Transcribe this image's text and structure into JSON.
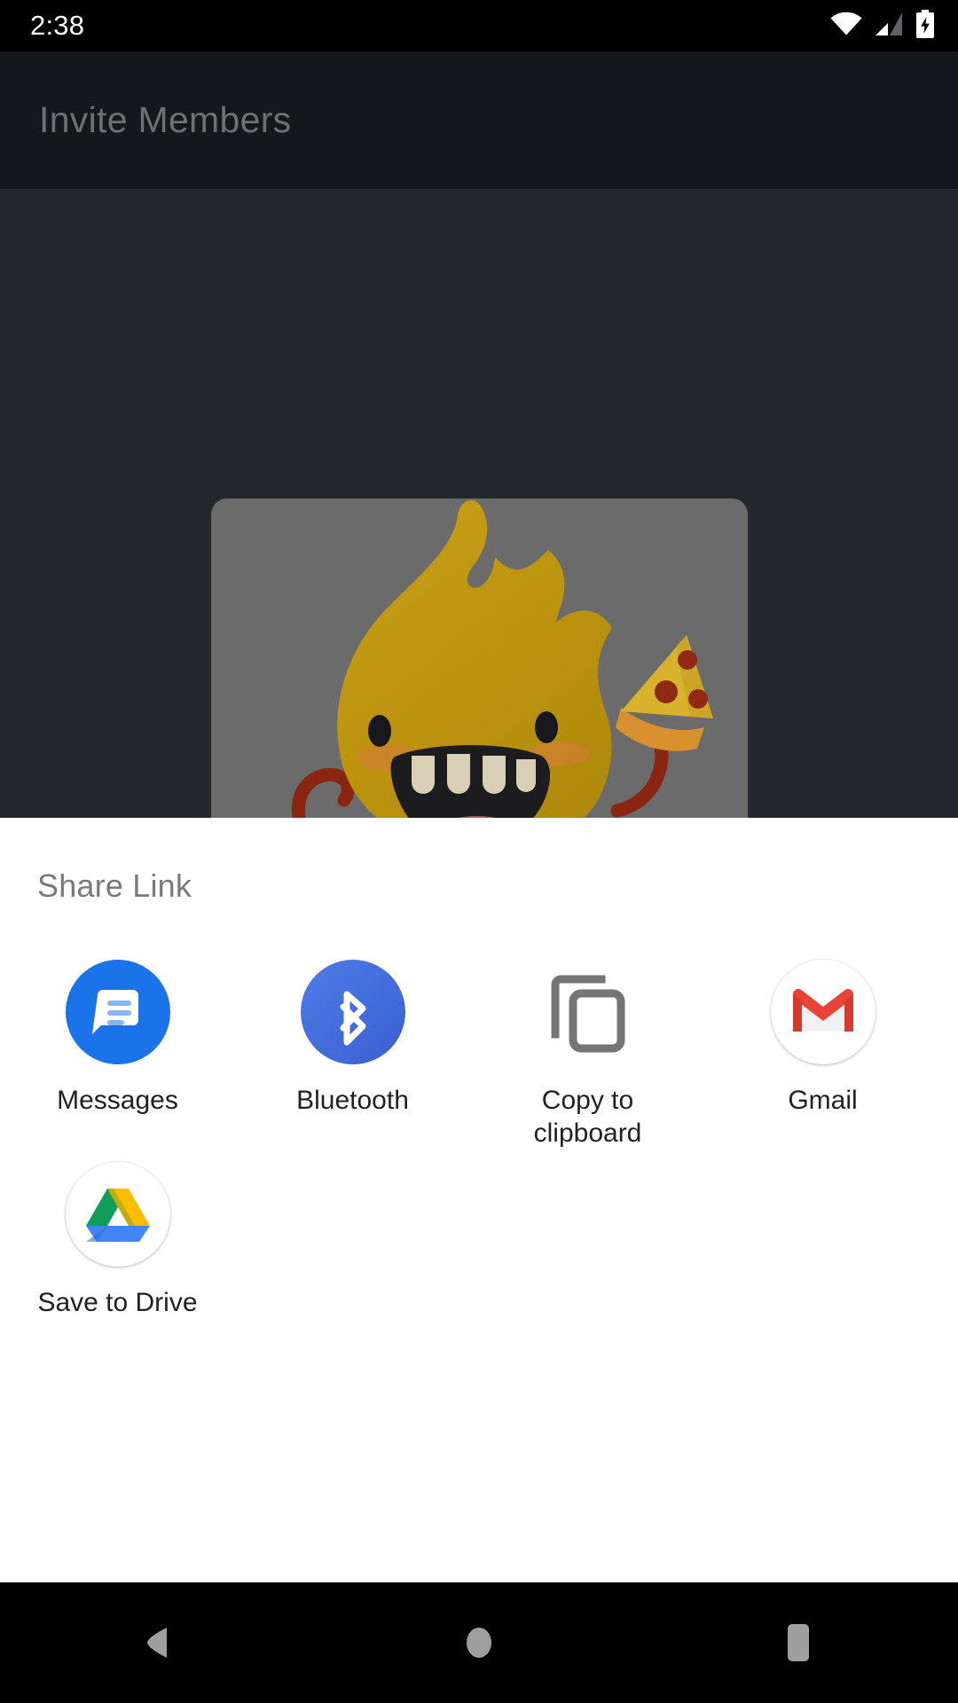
{
  "status_bar": {
    "time": "2:38",
    "icons": [
      "wifi-icon",
      "cellular-signal-icon",
      "battery-charging-icon"
    ]
  },
  "toolbar": {
    "title": "Invite Members"
  },
  "app_content": {
    "hero_image_alt": "yellow flame monster holding pizza slice",
    "card_background": "#6b6b6b",
    "background": "#24282c"
  },
  "share_sheet": {
    "title": "Share Link",
    "targets": [
      {
        "label": "Messages",
        "icon": "messages-icon",
        "color": "#1a73e8"
      },
      {
        "label": "Bluetooth",
        "icon": "bluetooth-icon",
        "color": "#4156c5"
      },
      {
        "label": "Copy to\nclipboard",
        "label_line1": "Copy to",
        "label_line2": "clipboard",
        "icon": "copy-to-clipboard-icon",
        "color": "#757575"
      },
      {
        "label": "Gmail",
        "icon": "gmail-icon",
        "color": "#ea4335"
      },
      {
        "label": "Save to Drive",
        "icon": "google-drive-icon",
        "color": "#0f9d58"
      }
    ]
  },
  "nav_bar": {
    "back": "back-button",
    "home": "home-button",
    "recents": "recents-button"
  }
}
